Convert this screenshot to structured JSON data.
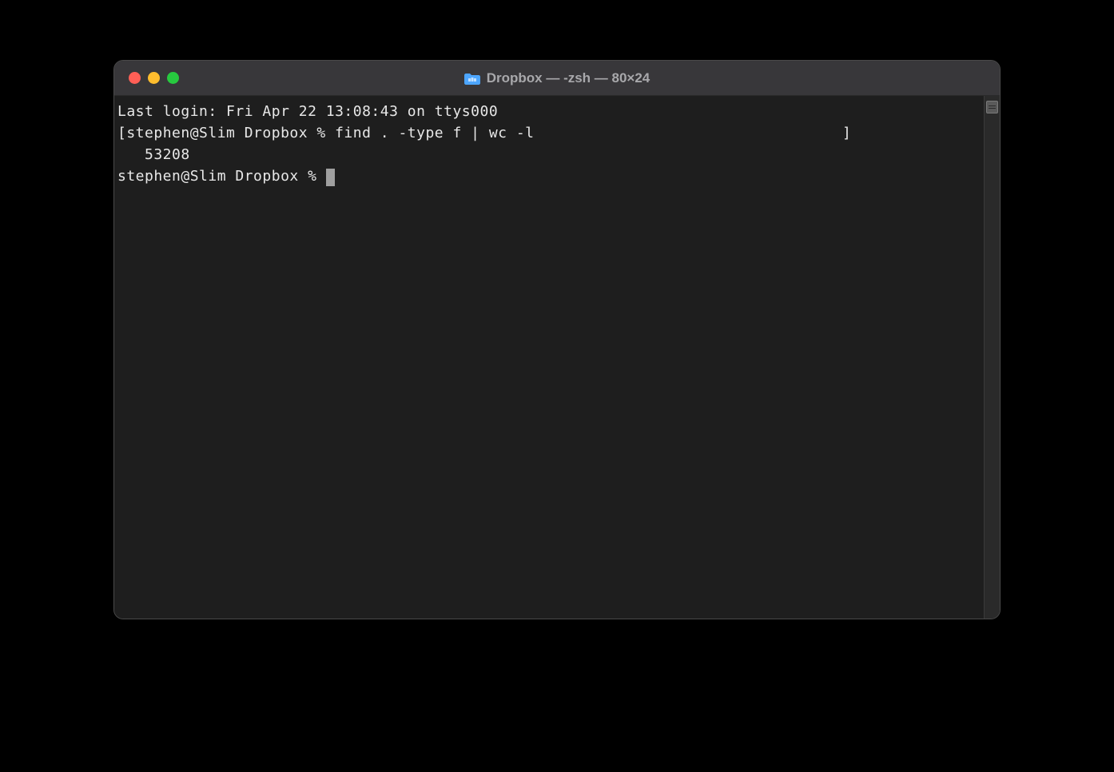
{
  "window": {
    "title": "Dropbox — -zsh — 80×24"
  },
  "terminal": {
    "lines": [
      {
        "prefix": "",
        "prompt": "",
        "text": "Last login: Fri Apr 22 13:08:43 on ttys000",
        "suffix": ""
      },
      {
        "prefix": "[",
        "prompt": "stephen@Slim Dropbox % ",
        "text": "find . -type f | wc -l",
        "suffix": "                                  ]"
      },
      {
        "prefix": "",
        "prompt": "",
        "text": "   53208",
        "suffix": ""
      },
      {
        "prefix": "",
        "prompt": "stephen@Slim Dropbox % ",
        "text": "",
        "suffix": ""
      }
    ]
  }
}
